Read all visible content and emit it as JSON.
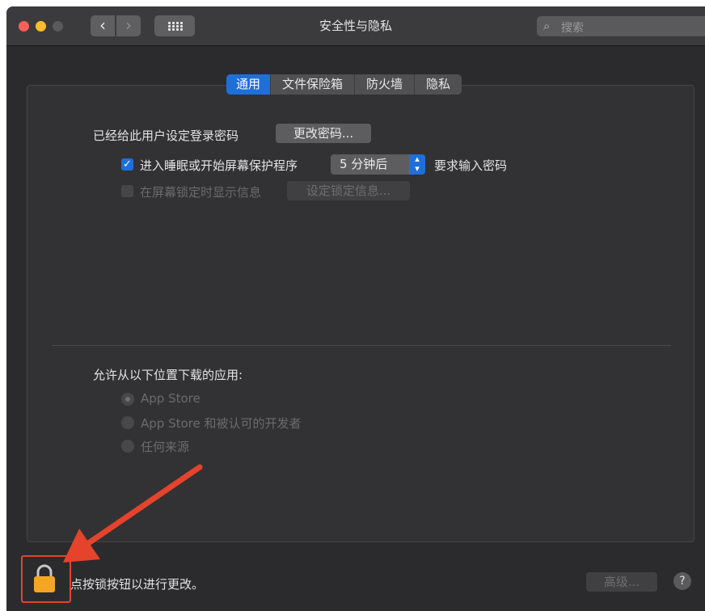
{
  "window": {
    "title": "安全性与隐私",
    "search_placeholder": "搜索",
    "nav": {
      "back_glyph": "‹",
      "forward_glyph": "›"
    }
  },
  "tabs": [
    {
      "label": "通用",
      "active": true
    },
    {
      "label": "文件保险箱",
      "active": false
    },
    {
      "label": "防火墙",
      "active": false
    },
    {
      "label": "隐私",
      "active": false
    }
  ],
  "general": {
    "password_label": "已经给此用户设定登录密码",
    "change_password_button": "更改密码...",
    "sleep_checkbox_label": "进入睡眠或开始屏幕保护程序",
    "sleep_checkbox_checked": true,
    "sleep_delay_value": "5 分钟后",
    "require_password_label": "要求输入密码",
    "lock_message_label": "在屏幕锁定时显示信息",
    "lock_message_checked": false,
    "set_lock_message_button": "设定锁定信息...",
    "downloads_heading": "允许从以下位置下载的应用:",
    "download_options": [
      {
        "label": "App Store",
        "selected": true
      },
      {
        "label": "App Store 和被认可的开发者",
        "selected": false
      },
      {
        "label": "任何来源",
        "selected": false
      }
    ]
  },
  "footer": {
    "lock_hint": "点按锁按钮以进行更改。",
    "advanced_button": "高级...",
    "help_glyph": "?"
  },
  "colors": {
    "accent": "#1f6fd9",
    "annotation": "#e5432b",
    "lock": "#f3a523"
  },
  "icons": [
    "search-icon",
    "lock-icon",
    "help-icon",
    "checkmark-icon",
    "chevron-updown-icon",
    "grid-icon"
  ]
}
